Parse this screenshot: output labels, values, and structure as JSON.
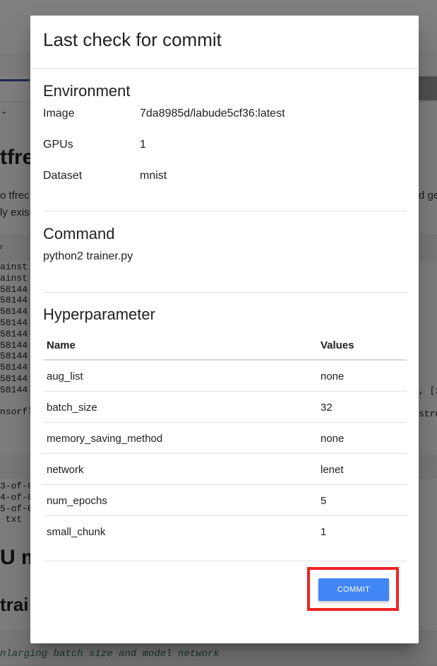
{
  "background": {
    "fragments": {
      "chevron": "⌄",
      "heading_1": "tfrec",
      "text_line_1": "o tfrec",
      "text_line_2": "ly exist",
      "right_text_1": "d ge",
      "small": "r",
      "code_block_1": "ainst\nainst\n58144\n58144\n58144\n58144\n58144\n58144\n58144\n58144\n58144\n58144\n\nnsorfl",
      "right_code_1": ", [1",
      "right_code_2": "stru",
      "code_block_2": "3-of-0\n4-of-0\n5-of-0\n txt",
      "heading_2": "U m",
      "heading_3": " trai",
      "italic_code": "nlarging batch size and model network"
    }
  },
  "dialog": {
    "title": "Last check for commit",
    "environment": {
      "section_title": "Environment",
      "rows": [
        {
          "label": "Image",
          "value": "7da8985d/labude5cf36:latest"
        },
        {
          "label": "GPUs",
          "value": "1"
        },
        {
          "label": "Dataset",
          "value": "mnist"
        }
      ]
    },
    "command": {
      "section_title": "Command",
      "text": "python2 trainer.py"
    },
    "hyperparameter": {
      "section_title": "Hyperparameter",
      "columns": [
        "Name",
        "Values"
      ],
      "rows": [
        {
          "name": "aug_list",
          "value": "none"
        },
        {
          "name": "batch_size",
          "value": "32"
        },
        {
          "name": "memory_saving_method",
          "value": "none"
        },
        {
          "name": "network",
          "value": "lenet"
        },
        {
          "name": "num_epochs",
          "value": "5"
        },
        {
          "name": "small_chunk",
          "value": "1"
        }
      ]
    },
    "commit_label": "COMMIT"
  },
  "colors": {
    "accent": "#4285f4",
    "highlight": "#f02222",
    "scrim": "#000000"
  }
}
